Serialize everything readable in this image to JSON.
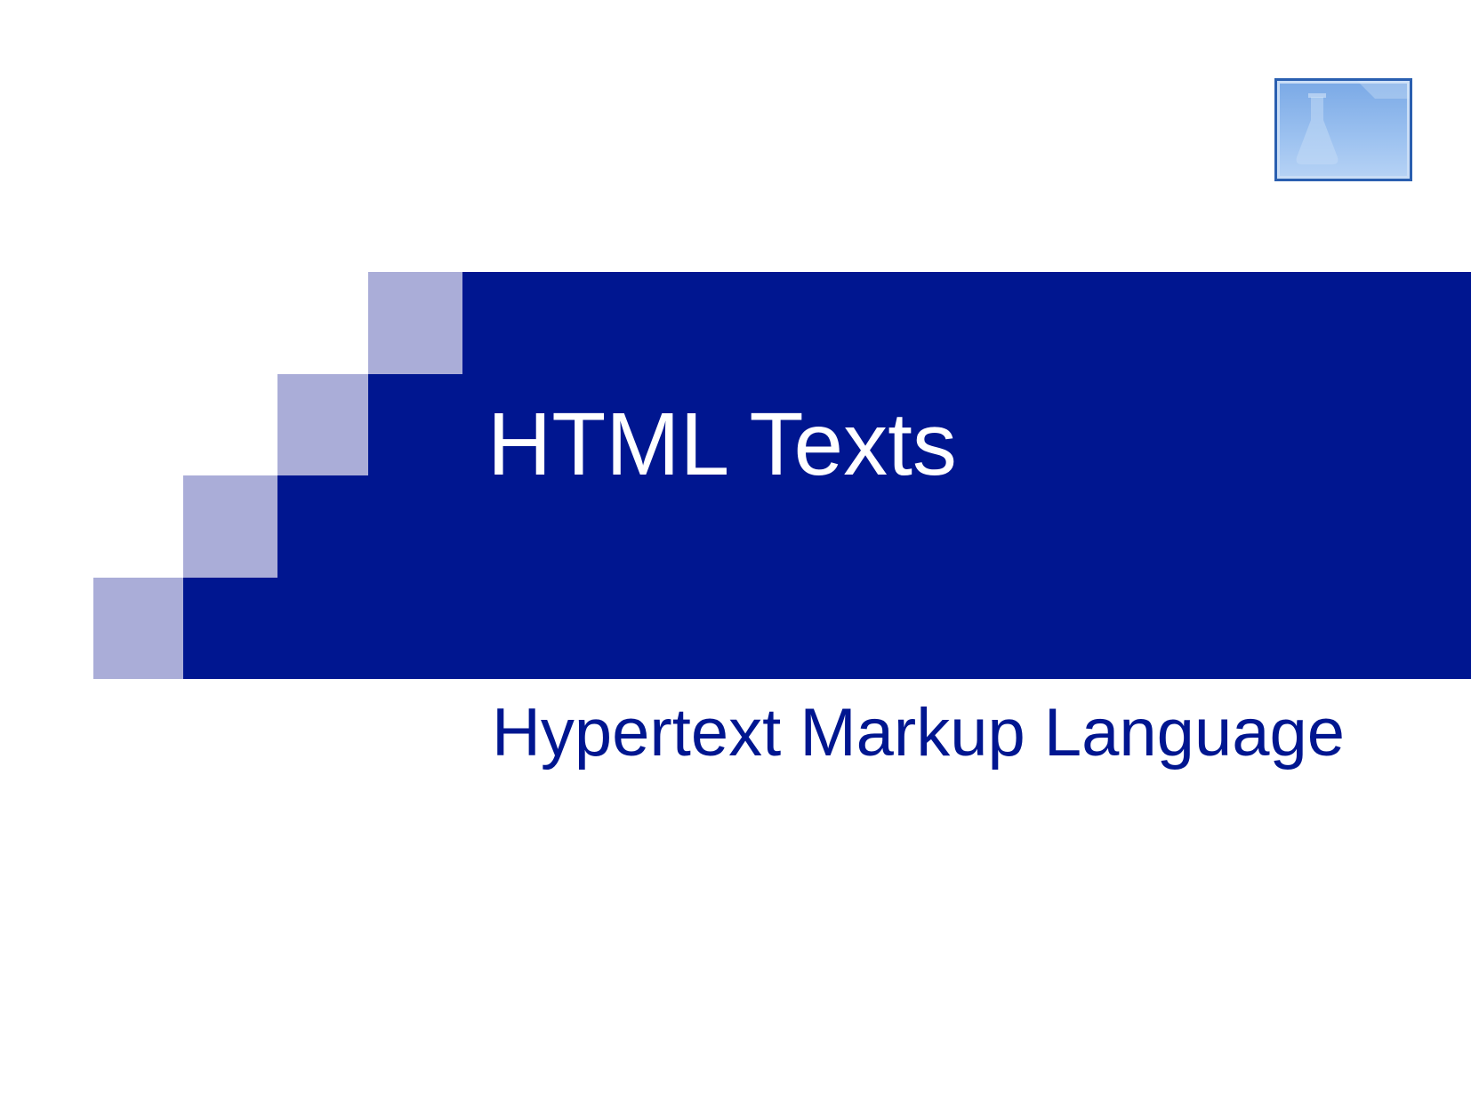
{
  "slide": {
    "title": "HTML Texts",
    "subtitle": "Hypertext Markup Language"
  },
  "colors": {
    "banner": "#001690",
    "squares": "#aaadd8",
    "subtitle_text": "#001690",
    "title_text": "#ffffff"
  },
  "logo": {
    "icon": "flask-icon"
  }
}
